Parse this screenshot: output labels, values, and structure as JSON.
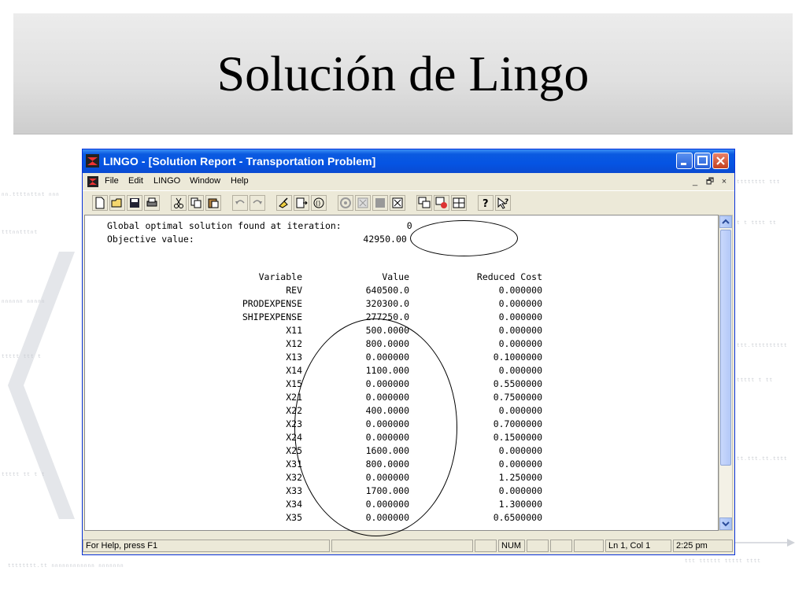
{
  "slide": {
    "title": "Solución de Lingo"
  },
  "window": {
    "title": "LINGO - [Solution Report - Transportation Problem]",
    "app_icon": "lingo-app-icon",
    "controls": [
      "minimize-icon",
      "maximize-icon",
      "close-icon"
    ]
  },
  "menu": {
    "items": [
      "File",
      "Edit",
      "LINGO",
      "Window",
      "Help"
    ],
    "mdi": [
      "_",
      "🗗",
      "×"
    ]
  },
  "toolbar": {
    "icons": [
      "new-icon",
      "open-icon",
      "save-icon",
      "print-icon",
      "cut-icon",
      "copy-icon",
      "paste-icon",
      "undo-icon",
      "redo-icon",
      "find-icon",
      "go-to-line-icon",
      "match-paren-icon",
      "solve-icon",
      "solution-icon",
      "matrix-icon",
      "options-icon",
      "send-to-back-icon",
      "close-all-icon",
      "tile-icon",
      "help-icon",
      "context-help-icon"
    ]
  },
  "report": {
    "line1": "Global optimal solution found at iteration:            0",
    "line2": "Objective value:                               42950.00",
    "header": {
      "variable": "Variable",
      "value": "Value",
      "reduced_cost": "Reduced Cost"
    },
    "rows": [
      {
        "variable": "REV",
        "value": "640500.0",
        "cost": "0.000000"
      },
      {
        "variable": "PRODEXPENSE",
        "value": "320300.0",
        "cost": "0.000000"
      },
      {
        "variable": "SHIPEXPENSE",
        "value": "277250.0",
        "cost": "0.000000"
      },
      {
        "variable": "X11",
        "value": "500.0000",
        "cost": "0.000000"
      },
      {
        "variable": "X12",
        "value": "800.0000",
        "cost": "0.000000"
      },
      {
        "variable": "X13",
        "value": "0.000000",
        "cost": "0.1000000"
      },
      {
        "variable": "X14",
        "value": "1100.000",
        "cost": "0.000000"
      },
      {
        "variable": "X15",
        "value": "0.000000",
        "cost": "0.5500000"
      },
      {
        "variable": "X21",
        "value": "0.000000",
        "cost": "0.7500000"
      },
      {
        "variable": "X22",
        "value": "400.0000",
        "cost": "0.000000"
      },
      {
        "variable": "X23",
        "value": "0.000000",
        "cost": "0.7000000"
      },
      {
        "variable": "X24",
        "value": "0.000000",
        "cost": "0.1500000"
      },
      {
        "variable": "X25",
        "value": "1600.000",
        "cost": "0.000000"
      },
      {
        "variable": "X31",
        "value": "800.0000",
        "cost": "0.000000"
      },
      {
        "variable": "X32",
        "value": "0.000000",
        "cost": "1.250000"
      },
      {
        "variable": "X33",
        "value": "1700.000",
        "cost": "0.000000"
      },
      {
        "variable": "X34",
        "value": "0.000000",
        "cost": "1.300000"
      },
      {
        "variable": "X35",
        "value": "0.000000",
        "cost": "0.6500000"
      }
    ]
  },
  "status": {
    "help": "For Help, press F1",
    "num": "NUM",
    "position": "Ln 1, Col 1",
    "time": "2:25 pm"
  }
}
